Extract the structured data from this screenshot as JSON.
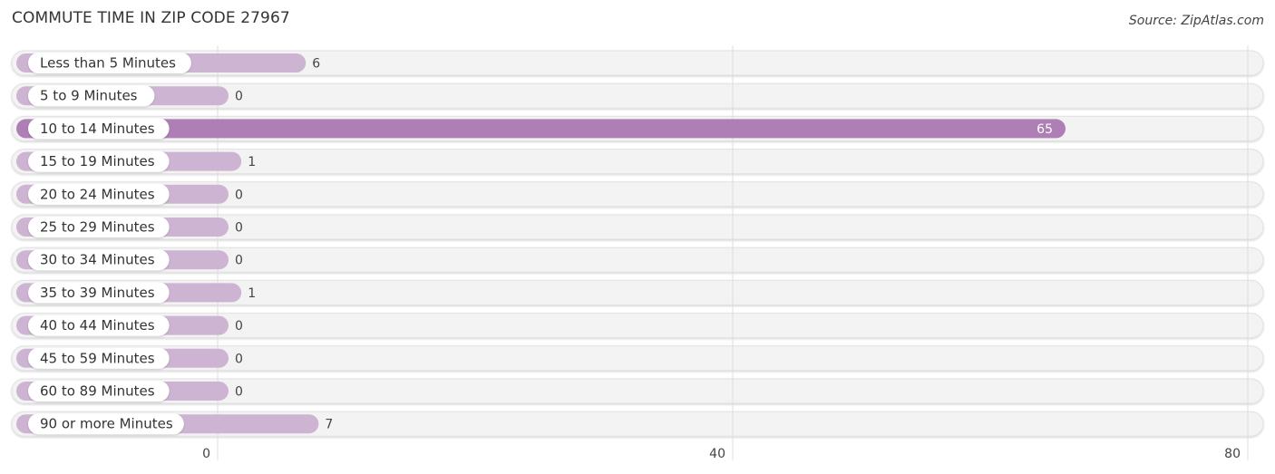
{
  "header": {
    "title": "COMMUTE TIME IN ZIP CODE 27967",
    "source": "Source: ZipAtlas.com"
  },
  "colors": {
    "bar": "#ceb4d3",
    "bar_highlight": "#ae7fb4",
    "track": "#f3f3f3",
    "grid": "#dddddd"
  },
  "chart_data": {
    "type": "bar",
    "orientation": "horizontal",
    "title": "COMMUTE TIME IN ZIP CODE 27967",
    "xlabel": "",
    "ylabel": "",
    "categories": [
      "Less than 5 Minutes",
      "5 to 9 Minutes",
      "10 to 14 Minutes",
      "15 to 19 Minutes",
      "20 to 24 Minutes",
      "25 to 29 Minutes",
      "30 to 34 Minutes",
      "35 to 39 Minutes",
      "40 to 44 Minutes",
      "45 to 59 Minutes",
      "60 to 89 Minutes",
      "90 or more Minutes"
    ],
    "values": [
      6,
      0,
      65,
      1,
      0,
      0,
      0,
      1,
      0,
      0,
      0,
      7
    ],
    "xlim": [
      0,
      80
    ],
    "xticks": [
      0,
      40,
      80
    ],
    "grid": true,
    "highlight_index": 2
  }
}
